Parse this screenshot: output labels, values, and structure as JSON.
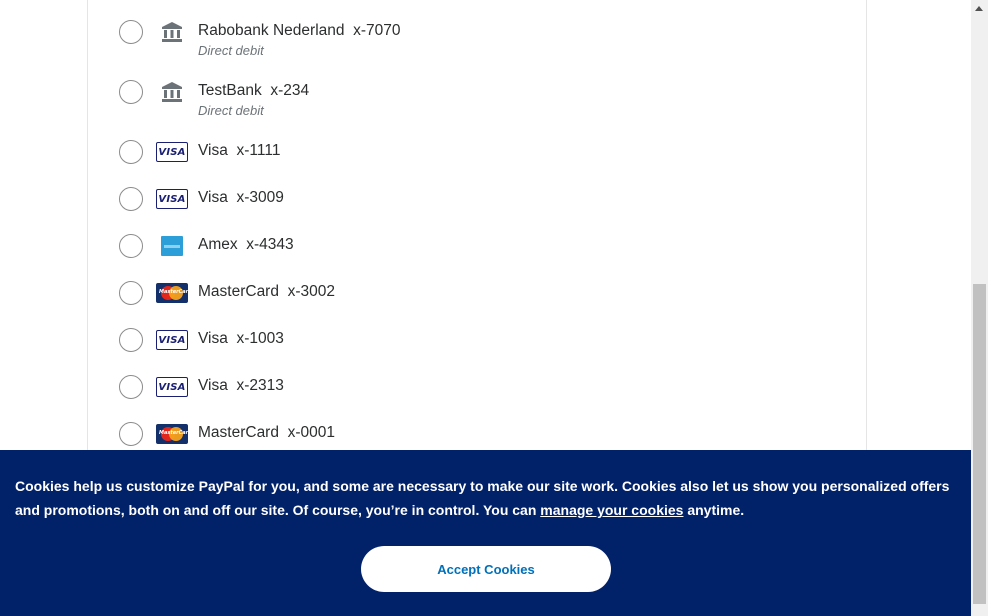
{
  "payment_methods": [
    {
      "name": "Rabobank Nederland",
      "suffix": "x-7070",
      "sub": "Direct debit",
      "icon": "bank-icon"
    },
    {
      "name": "TestBank",
      "suffix": "x-234",
      "sub": "Direct debit",
      "icon": "bank-icon"
    },
    {
      "name": "Visa",
      "suffix": "x-1111",
      "icon": "visa-icon"
    },
    {
      "name": "Visa",
      "suffix": "x-3009",
      "icon": "visa-icon"
    },
    {
      "name": "Amex",
      "suffix": "x-4343",
      "icon": "amex-icon"
    },
    {
      "name": "MasterCard",
      "suffix": "x-3002",
      "icon": "mastercard-icon"
    },
    {
      "name": "Visa",
      "suffix": "x-1003",
      "icon": "visa-icon"
    },
    {
      "name": "Visa",
      "suffix": "x-2313",
      "icon": "visa-icon"
    },
    {
      "name": "MasterCard",
      "suffix": "x-0001",
      "icon": "mastercard-icon"
    }
  ],
  "icons": {
    "visa_text": "VISA",
    "mastercard_text": "MasterCard"
  },
  "cookie_banner": {
    "text_before": "Cookies help us customize PayPal for you, and some are necessary to make our site work. Cookies also let us show you personalized offers and promotions, both on and off our site. Of course, you’re in control. You can ",
    "link": "manage your cookies",
    "text_after": " anytime.",
    "accept_label": "Accept Cookies",
    "background_color": "#012169"
  }
}
